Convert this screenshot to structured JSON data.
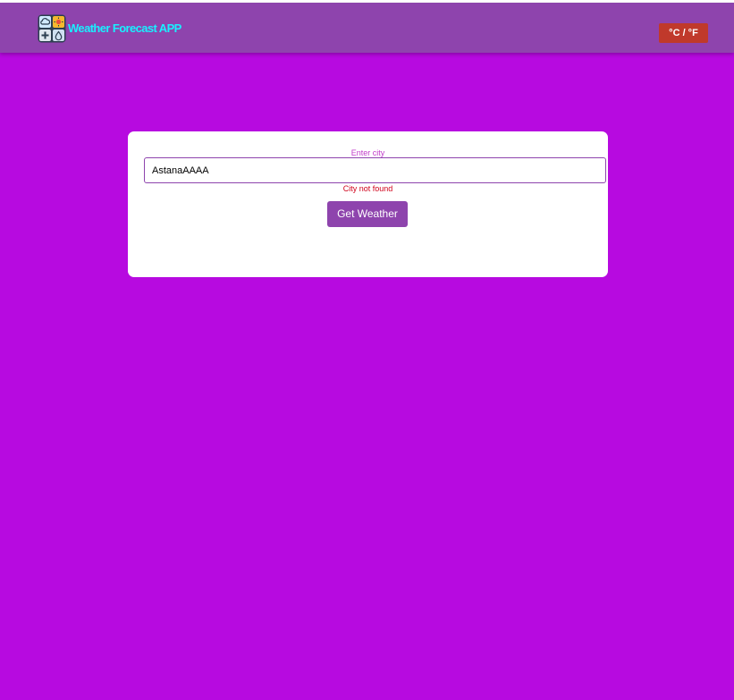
{
  "header": {
    "app_title": "Weather Forecast APP",
    "logo_icon": "weather-app-logo-icon",
    "unit_toggle_label": "°C / °F"
  },
  "search": {
    "label": "Enter city",
    "value": "AstanaAAAA",
    "error": "City not found",
    "submit_label": "Get Weather"
  },
  "colors": {
    "page_background": "#b70ae0",
    "header_background": "#8e44ad",
    "title_color": "#19f0ff",
    "unit_button": "#c0392b",
    "primary_button": "#8e44ad",
    "error_text": "#d0021b",
    "label_text": "#c03bc9"
  }
}
